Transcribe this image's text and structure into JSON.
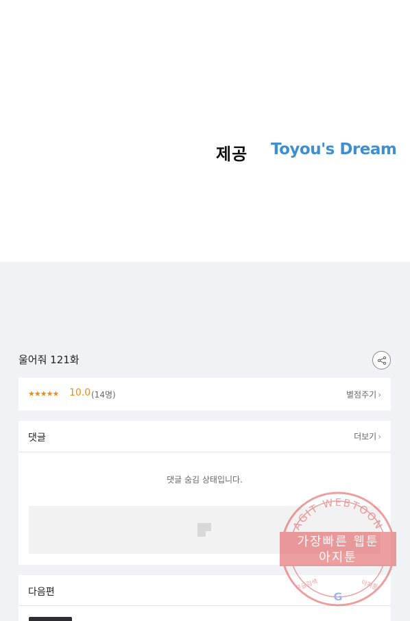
{
  "credit": {
    "label": "제공",
    "publisher_logo_text": "Toyou's Dream"
  },
  "episode": {
    "title": "울어줘 121화"
  },
  "rating": {
    "stars": "★★★★★",
    "score": "10.0",
    "votes": "(14명)",
    "rate_link": "별점주기"
  },
  "comments": {
    "title": "댓글",
    "more": "더보기",
    "hidden_message": "댓글 숨김 상태입니다."
  },
  "next": {
    "title": "다음편"
  },
  "watermark": {
    "arc_text": "AGIT WEBTOON",
    "line1": "가장빠른 웹툰",
    "line2": "아지툰",
    "small_left": "구글검색",
    "small_right": "아지툰",
    "google": "G"
  },
  "colors": {
    "accent_orange": "#f08a13",
    "publisher_blue": "#3f8fcf",
    "stamp_red": "#e05050"
  }
}
